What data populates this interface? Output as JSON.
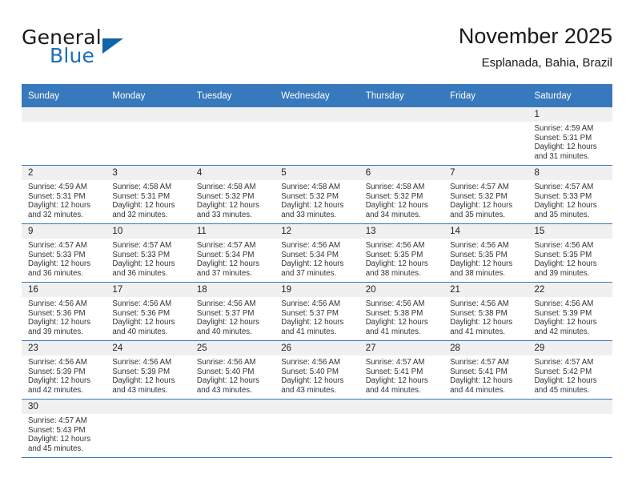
{
  "brand": {
    "name_part1": "General",
    "name_part2": "Blue",
    "logo_icon": "triangle-flag-icon",
    "accent_color": "#1064a8"
  },
  "header": {
    "title": "November 2025",
    "subtitle": "Esplanada, Bahia, Brazil"
  },
  "theme": {
    "header_row_color": "#3879bd",
    "daynum_band_color": "#f0f0f0",
    "grid_line_color": "#3879bd"
  },
  "weekday_headers": [
    "Sunday",
    "Monday",
    "Tuesday",
    "Wednesday",
    "Thursday",
    "Friday",
    "Saturday"
  ],
  "weeks": [
    [
      {
        "day": "",
        "blank": true,
        "sunrise": "",
        "sunset": "",
        "daylight1": "",
        "daylight2": ""
      },
      {
        "day": "",
        "blank": true,
        "sunrise": "",
        "sunset": "",
        "daylight1": "",
        "daylight2": ""
      },
      {
        "day": "",
        "blank": true,
        "sunrise": "",
        "sunset": "",
        "daylight1": "",
        "daylight2": ""
      },
      {
        "day": "",
        "blank": true,
        "sunrise": "",
        "sunset": "",
        "daylight1": "",
        "daylight2": ""
      },
      {
        "day": "",
        "blank": true,
        "sunrise": "",
        "sunset": "",
        "daylight1": "",
        "daylight2": ""
      },
      {
        "day": "",
        "blank": true,
        "sunrise": "",
        "sunset": "",
        "daylight1": "",
        "daylight2": ""
      },
      {
        "day": "1",
        "sunrise": "Sunrise: 4:59 AM",
        "sunset": "Sunset: 5:31 PM",
        "daylight1": "Daylight: 12 hours",
        "daylight2": "and 31 minutes."
      }
    ],
    [
      {
        "day": "2",
        "sunrise": "Sunrise: 4:59 AM",
        "sunset": "Sunset: 5:31 PM",
        "daylight1": "Daylight: 12 hours",
        "daylight2": "and 32 minutes."
      },
      {
        "day": "3",
        "sunrise": "Sunrise: 4:58 AM",
        "sunset": "Sunset: 5:31 PM",
        "daylight1": "Daylight: 12 hours",
        "daylight2": "and 32 minutes."
      },
      {
        "day": "4",
        "sunrise": "Sunrise: 4:58 AM",
        "sunset": "Sunset: 5:32 PM",
        "daylight1": "Daylight: 12 hours",
        "daylight2": "and 33 minutes."
      },
      {
        "day": "5",
        "sunrise": "Sunrise: 4:58 AM",
        "sunset": "Sunset: 5:32 PM",
        "daylight1": "Daylight: 12 hours",
        "daylight2": "and 33 minutes."
      },
      {
        "day": "6",
        "sunrise": "Sunrise: 4:58 AM",
        "sunset": "Sunset: 5:32 PM",
        "daylight1": "Daylight: 12 hours",
        "daylight2": "and 34 minutes."
      },
      {
        "day": "7",
        "sunrise": "Sunrise: 4:57 AM",
        "sunset": "Sunset: 5:32 PM",
        "daylight1": "Daylight: 12 hours",
        "daylight2": "and 35 minutes."
      },
      {
        "day": "8",
        "sunrise": "Sunrise: 4:57 AM",
        "sunset": "Sunset: 5:33 PM",
        "daylight1": "Daylight: 12 hours",
        "daylight2": "and 35 minutes."
      }
    ],
    [
      {
        "day": "9",
        "sunrise": "Sunrise: 4:57 AM",
        "sunset": "Sunset: 5:33 PM",
        "daylight1": "Daylight: 12 hours",
        "daylight2": "and 36 minutes."
      },
      {
        "day": "10",
        "sunrise": "Sunrise: 4:57 AM",
        "sunset": "Sunset: 5:33 PM",
        "daylight1": "Daylight: 12 hours",
        "daylight2": "and 36 minutes."
      },
      {
        "day": "11",
        "sunrise": "Sunrise: 4:57 AM",
        "sunset": "Sunset: 5:34 PM",
        "daylight1": "Daylight: 12 hours",
        "daylight2": "and 37 minutes."
      },
      {
        "day": "12",
        "sunrise": "Sunrise: 4:56 AM",
        "sunset": "Sunset: 5:34 PM",
        "daylight1": "Daylight: 12 hours",
        "daylight2": "and 37 minutes."
      },
      {
        "day": "13",
        "sunrise": "Sunrise: 4:56 AM",
        "sunset": "Sunset: 5:35 PM",
        "daylight1": "Daylight: 12 hours",
        "daylight2": "and 38 minutes."
      },
      {
        "day": "14",
        "sunrise": "Sunrise: 4:56 AM",
        "sunset": "Sunset: 5:35 PM",
        "daylight1": "Daylight: 12 hours",
        "daylight2": "and 38 minutes."
      },
      {
        "day": "15",
        "sunrise": "Sunrise: 4:56 AM",
        "sunset": "Sunset: 5:35 PM",
        "daylight1": "Daylight: 12 hours",
        "daylight2": "and 39 minutes."
      }
    ],
    [
      {
        "day": "16",
        "sunrise": "Sunrise: 4:56 AM",
        "sunset": "Sunset: 5:36 PM",
        "daylight1": "Daylight: 12 hours",
        "daylight2": "and 39 minutes."
      },
      {
        "day": "17",
        "sunrise": "Sunrise: 4:56 AM",
        "sunset": "Sunset: 5:36 PM",
        "daylight1": "Daylight: 12 hours",
        "daylight2": "and 40 minutes."
      },
      {
        "day": "18",
        "sunrise": "Sunrise: 4:56 AM",
        "sunset": "Sunset: 5:37 PM",
        "daylight1": "Daylight: 12 hours",
        "daylight2": "and 40 minutes."
      },
      {
        "day": "19",
        "sunrise": "Sunrise: 4:56 AM",
        "sunset": "Sunset: 5:37 PM",
        "daylight1": "Daylight: 12 hours",
        "daylight2": "and 41 minutes."
      },
      {
        "day": "20",
        "sunrise": "Sunrise: 4:56 AM",
        "sunset": "Sunset: 5:38 PM",
        "daylight1": "Daylight: 12 hours",
        "daylight2": "and 41 minutes."
      },
      {
        "day": "21",
        "sunrise": "Sunrise: 4:56 AM",
        "sunset": "Sunset: 5:38 PM",
        "daylight1": "Daylight: 12 hours",
        "daylight2": "and 41 minutes."
      },
      {
        "day": "22",
        "sunrise": "Sunrise: 4:56 AM",
        "sunset": "Sunset: 5:39 PM",
        "daylight1": "Daylight: 12 hours",
        "daylight2": "and 42 minutes."
      }
    ],
    [
      {
        "day": "23",
        "sunrise": "Sunrise: 4:56 AM",
        "sunset": "Sunset: 5:39 PM",
        "daylight1": "Daylight: 12 hours",
        "daylight2": "and 42 minutes."
      },
      {
        "day": "24",
        "sunrise": "Sunrise: 4:56 AM",
        "sunset": "Sunset: 5:39 PM",
        "daylight1": "Daylight: 12 hours",
        "daylight2": "and 43 minutes."
      },
      {
        "day": "25",
        "sunrise": "Sunrise: 4:56 AM",
        "sunset": "Sunset: 5:40 PM",
        "daylight1": "Daylight: 12 hours",
        "daylight2": "and 43 minutes."
      },
      {
        "day": "26",
        "sunrise": "Sunrise: 4:56 AM",
        "sunset": "Sunset: 5:40 PM",
        "daylight1": "Daylight: 12 hours",
        "daylight2": "and 43 minutes."
      },
      {
        "day": "27",
        "sunrise": "Sunrise: 4:57 AM",
        "sunset": "Sunset: 5:41 PM",
        "daylight1": "Daylight: 12 hours",
        "daylight2": "and 44 minutes."
      },
      {
        "day": "28",
        "sunrise": "Sunrise: 4:57 AM",
        "sunset": "Sunset: 5:41 PM",
        "daylight1": "Daylight: 12 hours",
        "daylight2": "and 44 minutes."
      },
      {
        "day": "29",
        "sunrise": "Sunrise: 4:57 AM",
        "sunset": "Sunset: 5:42 PM",
        "daylight1": "Daylight: 12 hours",
        "daylight2": "and 45 minutes."
      }
    ],
    [
      {
        "day": "30",
        "sunrise": "Sunrise: 4:57 AM",
        "sunset": "Sunset: 5:43 PM",
        "daylight1": "Daylight: 12 hours",
        "daylight2": "and 45 minutes."
      },
      {
        "day": "",
        "blank": true,
        "sunrise": "",
        "sunset": "",
        "daylight1": "",
        "daylight2": ""
      },
      {
        "day": "",
        "blank": true,
        "sunrise": "",
        "sunset": "",
        "daylight1": "",
        "daylight2": ""
      },
      {
        "day": "",
        "blank": true,
        "sunrise": "",
        "sunset": "",
        "daylight1": "",
        "daylight2": ""
      },
      {
        "day": "",
        "blank": true,
        "sunrise": "",
        "sunset": "",
        "daylight1": "",
        "daylight2": ""
      },
      {
        "day": "",
        "blank": true,
        "sunrise": "",
        "sunset": "",
        "daylight1": "",
        "daylight2": ""
      },
      {
        "day": "",
        "blank": true,
        "sunrise": "",
        "sunset": "",
        "daylight1": "",
        "daylight2": ""
      }
    ]
  ]
}
